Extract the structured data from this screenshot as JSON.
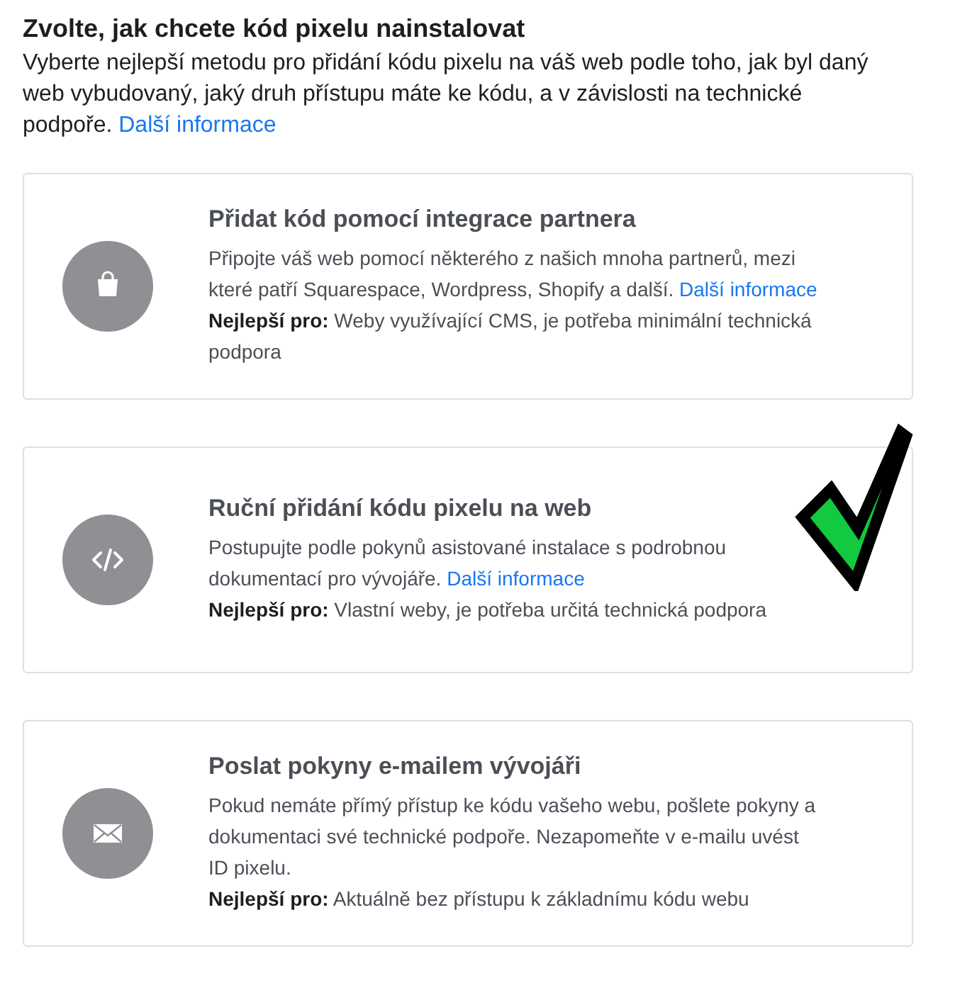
{
  "heading": "Zvolte, jak chcete kód pixelu nainstalovat",
  "intro": {
    "text": "Vyberte nejlepší metodu pro přidání kódu pixelu na váš web podle toho, jak byl daný web vybudovaný, jaký druh přístupu máte ke kódu, a v závislosti na technické podpoře.",
    "link": "Další informace"
  },
  "options": [
    {
      "kind": "bag",
      "selected": false,
      "title": "Přidat kód pomocí integrace partnera",
      "text": "Připojte váš web pomocí některého z našich mnoha partnerů, mezi které patří Squarespace, Wordpress, Shopify a další.",
      "link": "Další informace",
      "best_for": "**Nejlepší pro:** Weby využívající CMS, je potřeba minimální technická podpora"
    },
    {
      "kind": "code",
      "selected": true,
      "title": "Ruční přidání kódu pixelu na web",
      "text": "Postupujte podle pokynů asistované instalace s podrobnou dokumentací pro vývojáře.",
      "link": "Další informace",
      "best_for": "**Nejlepší pro:** Vlastní weby, je potřeba určitá technická podpora"
    },
    {
      "kind": "mail",
      "selected": false,
      "title": "Poslat pokyny e-mailem vývojáři",
      "text": "Pokud nemáte přímý přístup ke kódu vašeho webu, pošlete pokyny a dokumentaci své technické podpoře. Nezapomeňte v e-mailu uvést ID pixelu.",
      "best_for": "**Nejlepší pro:** Aktuálně bez přístupu k základnímu kódu webu"
    }
  ]
}
